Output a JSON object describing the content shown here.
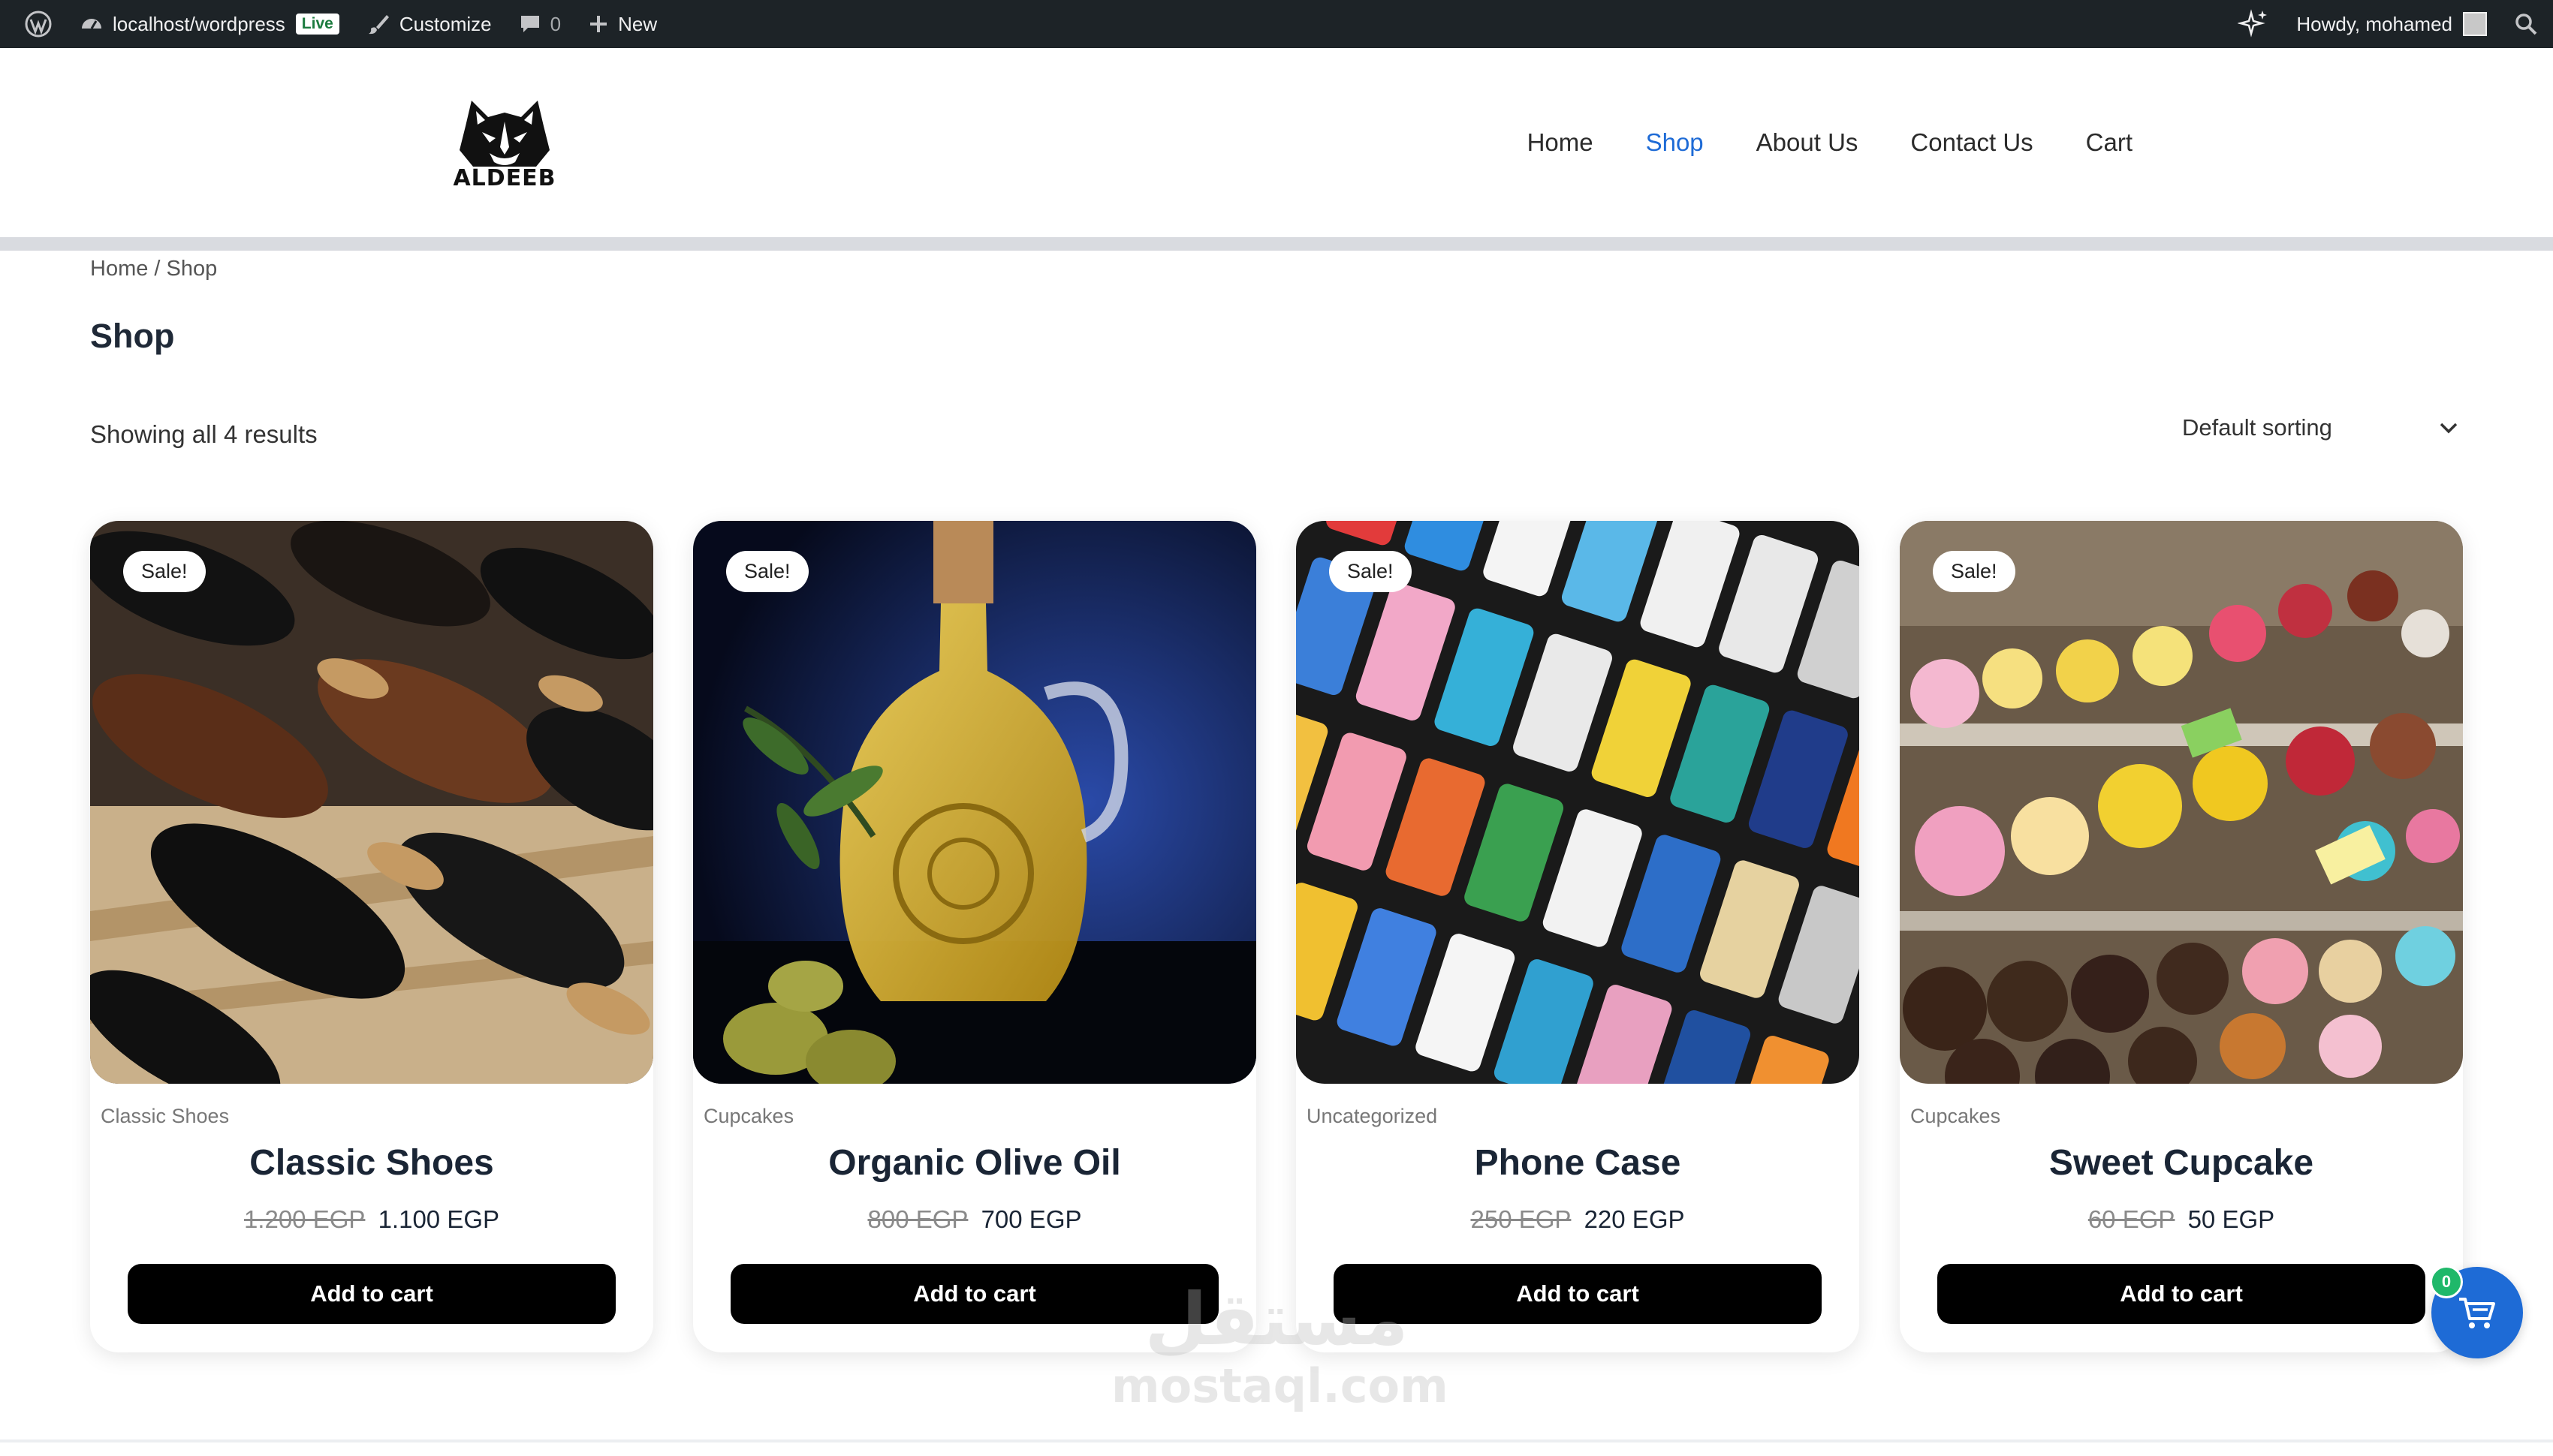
{
  "admin_bar": {
    "site": "localhost/wordpress",
    "live_badge": "Live",
    "customize": "Customize",
    "comments_count": "0",
    "new": "New",
    "greeting": "Howdy, mohamed"
  },
  "header": {
    "logo_text": "ALDEEB",
    "nav": [
      {
        "label": "Home",
        "active": false
      },
      {
        "label": "Shop",
        "active": true
      },
      {
        "label": "About Us",
        "active": false
      },
      {
        "label": "Contact Us",
        "active": false
      },
      {
        "label": "Cart",
        "active": false
      }
    ]
  },
  "breadcrumb": "Home / Shop",
  "page_title": "Shop",
  "result_count": "Showing all 4 results",
  "sorting": {
    "selected": "Default sorting"
  },
  "products": [
    {
      "badge": "Sale!",
      "category": "Classic Shoes",
      "name": "Classic Shoes",
      "old_price": "1.200 EGP",
      "price": "1.100 EGP",
      "button": "Add to cart"
    },
    {
      "badge": "Sale!",
      "category": "Cupcakes",
      "name": "Organic Olive Oil",
      "old_price": "800 EGP",
      "price": "700 EGP",
      "button": "Add to cart"
    },
    {
      "badge": "Sale!",
      "category": "Uncategorized",
      "name": "Phone Case",
      "old_price": "250 EGP",
      "price": "220 EGP",
      "button": "Add to cart"
    },
    {
      "badge": "Sale!",
      "category": "Cupcakes",
      "name": "Sweet Cupcake",
      "old_price": "60 EGP",
      "price": "50 EGP",
      "button": "Add to cart"
    }
  ],
  "floating_cart": {
    "count": "0"
  },
  "watermark": {
    "arabic": "مستقل",
    "latin": "mostaql.com"
  },
  "colors": {
    "accent": "#1e6bd6",
    "admin_bar": "#1d2327",
    "button": "#000000",
    "cart_badge": "#1fb86a"
  }
}
